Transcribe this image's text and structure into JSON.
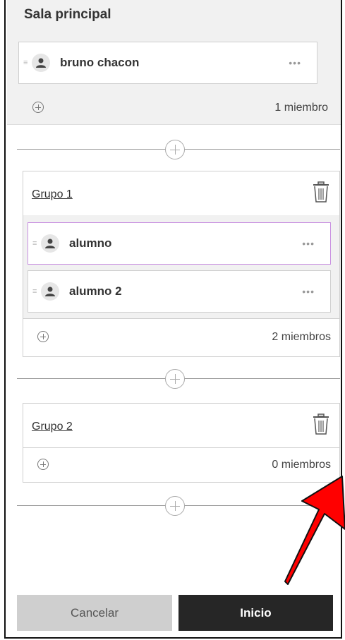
{
  "main_room": {
    "title": "Sala principal",
    "members": [
      {
        "name": "bruno chacon"
      }
    ],
    "count": "1 miembro"
  },
  "groups": [
    {
      "name": "Grupo 1",
      "members": [
        {
          "name": "alumno"
        },
        {
          "name": "alumno 2"
        }
      ],
      "count": "2 miembros"
    },
    {
      "name": "Grupo 2",
      "members": [],
      "count": "0 miembros"
    }
  ],
  "footer": {
    "cancel_label": "Cancelar",
    "start_label": "Inicio"
  },
  "colors": {
    "accent_selected_border": "#c88fe0",
    "start_button": "#262626",
    "cancel_button": "#cfcfcf",
    "annotation_arrow": "#ff0000"
  },
  "icons": {
    "drag": "drag-handle-icon",
    "avatar": "user-avatar-icon",
    "more": "more-options-icon",
    "add": "add-circle-icon",
    "trash": "trash-icon"
  }
}
